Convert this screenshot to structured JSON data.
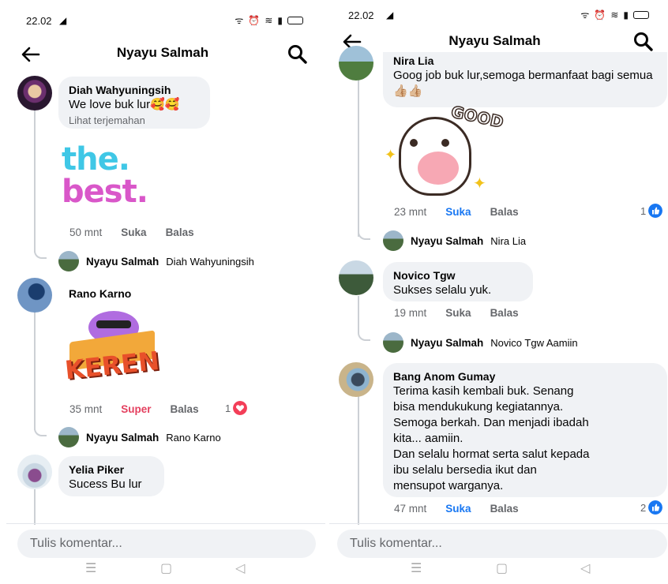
{
  "left": {
    "status_time": "22.02",
    "title": "Nyayu Salmah",
    "comments": [
      {
        "name": "Diah Wahyuningsih",
        "text": "We love buk lur🥰🥰",
        "translate": "Lihat terjemahan",
        "sticker_text_line1": "the.",
        "sticker_text_line2": "best.",
        "time": "50 mnt",
        "like": "Suka",
        "reply": "Balas",
        "reply_author": "Nyayu Salmah",
        "reply_tag": "Diah Wahyuningsih"
      },
      {
        "name": "Rano Karno",
        "sticker_text": "KEREN",
        "time": "35 mnt",
        "like": "Super",
        "reply": "Balas",
        "reaction_count": "1",
        "reply_author": "Nyayu Salmah",
        "reply_tag": "Rano Karno"
      },
      {
        "name": "Yelia Piker",
        "text": "Sucess Bu lur"
      }
    ],
    "composer_placeholder": "Tulis komentar..."
  },
  "right": {
    "status_time": "22.02",
    "title": "Nyayu Salmah",
    "comments": [
      {
        "name": "Nira Lia",
        "text": "Goog job buk lur,semoga bermanfaat bagi semua👍🏼👍🏼",
        "sticker_text": "GOOD",
        "time": "23 mnt",
        "like": "Suka",
        "reply": "Balas",
        "reaction_count": "1",
        "reply_author": "Nyayu Salmah",
        "reply_tag": "Nira Lia"
      },
      {
        "name": "Novico Tgw",
        "text": "Sukses selalu yuk.",
        "time": "19 mnt",
        "like": "Suka",
        "reply": "Balas",
        "reply_author": "Nyayu Salmah",
        "reply_tag": "Novico Tgw Aamiin"
      },
      {
        "name": "Bang Anom Gumay",
        "text_lines": [
          "Terima kasih kembali buk. Senang",
          "bisa mendukukung kegiatannya.",
          "Semoga berkah. Dan menjadi ibadah",
          "kita... aamiin.",
          "Dan selalu hormat serta salut kepada",
          "ibu selalu bersedia ikut dan",
          "mensupot warganya."
        ],
        "time": "47 mnt",
        "like": "Suka",
        "reply": "Balas",
        "reaction_count": "2"
      }
    ],
    "composer_placeholder": "Tulis komentar..."
  },
  "colors": {
    "accent_blue": "#1877f2",
    "super_red": "#e4405f",
    "bubble_gray": "#f0f2f5",
    "meta_gray": "#65676b"
  },
  "icons": [
    "back-arrow-icon",
    "search-icon",
    "like-reaction-icon",
    "love-reaction-icon",
    "menu-icon",
    "home-icon",
    "back-triangle-icon"
  ]
}
